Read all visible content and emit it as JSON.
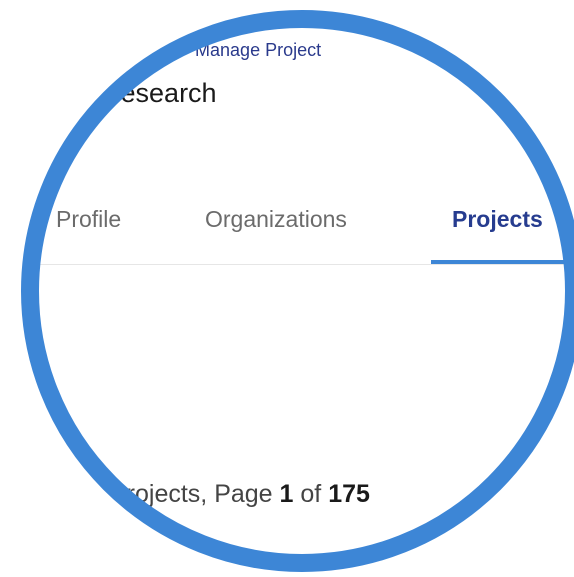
{
  "breadcrumb": "board - Manage Project",
  "org_title": "gy Research",
  "tabs": [
    {
      "label": "Profile",
      "active": false
    },
    {
      "label": "Organizations",
      "active": false
    },
    {
      "label": "Projects",
      "active": true
    }
  ],
  "pager": {
    "prefix": "Projects, Page ",
    "current": "1",
    "of": " of ",
    "total": "175"
  },
  "colors": {
    "ring": "#3d86d6",
    "accent": "#263c8f",
    "tab_inactive": "#6b6b6b"
  }
}
